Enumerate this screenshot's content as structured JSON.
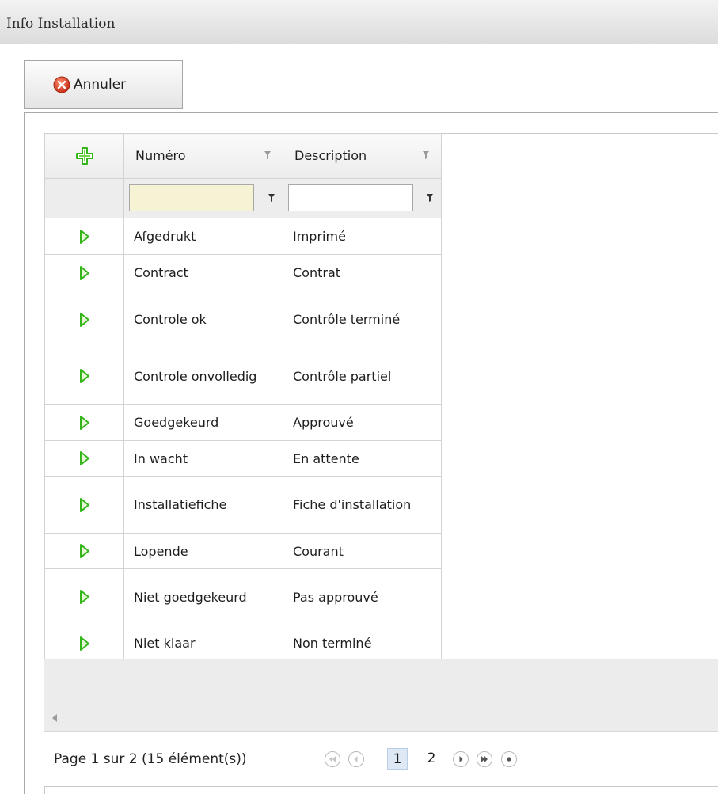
{
  "window": {
    "title": "Info Installation"
  },
  "toolbar": {
    "cancel_label": "Annuler",
    "cancel_icon": "red-x-circle-icon"
  },
  "grid": {
    "columns": [
      {
        "label": "",
        "icon": "green-plus-icon"
      },
      {
        "label": "Numéro",
        "icon": "filter-funnel-icon"
      },
      {
        "label": "Description",
        "icon": "filter-funnel-icon"
      }
    ],
    "filter": {
      "numero_value": "",
      "description_value": ""
    },
    "rows": [
      {
        "numero": "Afgedrukt",
        "description": "Imprimé"
      },
      {
        "numero": "Contract",
        "description": "Contrat"
      },
      {
        "numero": "Controle ok",
        "description": "Contrôle terminé"
      },
      {
        "numero": "Controle onvolledig",
        "description": "Contrôle partiel"
      },
      {
        "numero": "Goedgekeurd",
        "description": "Approuvé"
      },
      {
        "numero": "In wacht",
        "description": "En attente"
      },
      {
        "numero": "Installatiefiche",
        "description": "Fiche d'installation"
      },
      {
        "numero": "Lopende",
        "description": "Courant"
      },
      {
        "numero": "Niet goedgekeurd",
        "description": "Pas approuvé"
      },
      {
        "numero": "Niet klaar",
        "description": "Non terminé"
      }
    ]
  },
  "pager": {
    "summary": "Page 1 sur 2 (15 élément(s))",
    "pages": [
      "1",
      "2"
    ],
    "current_page": "1"
  },
  "colors": {
    "accent_green": "#34b51a",
    "cancel_red": "#d9452b",
    "current_page_bg": "#dfe9f6"
  }
}
